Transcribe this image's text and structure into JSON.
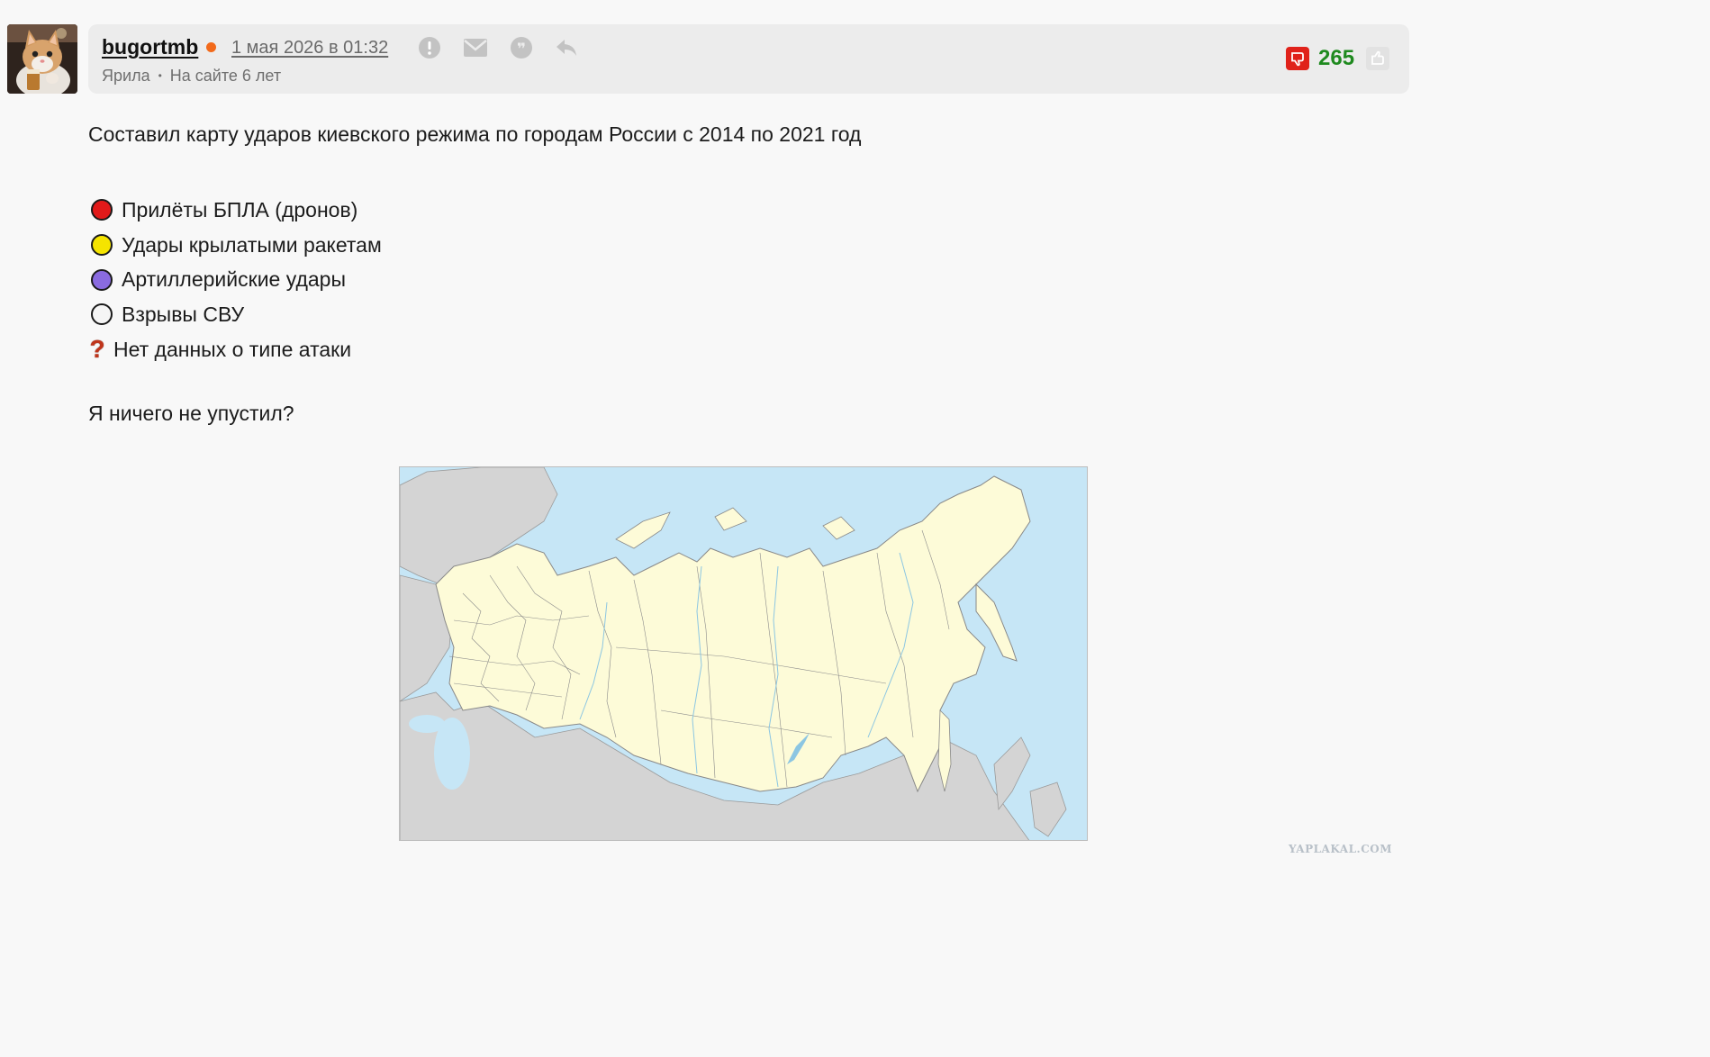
{
  "post": {
    "author": "bugortmb",
    "online_color": "#f26a1b",
    "date": "1 мая 2026 в 01:32",
    "user_status": "Ярила",
    "meta_separator": "•",
    "member_since": "На сайте 6 лет",
    "rating": "265",
    "rating_color": "#1f8a1f",
    "icons": [
      "report-icon",
      "message-icon",
      "quote-icon",
      "reply-icon",
      "dislike-icon",
      "like-icon"
    ]
  },
  "content": {
    "intro": "Составил карту ударов киевского режима по городам России с 2014 по 2021 год",
    "legend": [
      {
        "label": "Прилёты БПЛА (дронов)",
        "color": "#e11a1a"
      },
      {
        "label": "Удары крылатыми ракетам",
        "color": "#f5e400"
      },
      {
        "label": "Артиллерийские удары",
        "color": "#8a6be0"
      },
      {
        "label": "Взрывы СВУ",
        "color": "#f5f5f5"
      },
      {
        "label": "Нет данных о типе атаки",
        "icon": "question-mark-icon"
      }
    ],
    "closing": "Я ничего не упустил?"
  },
  "map": {
    "icon": "russia-map",
    "colors": {
      "sea": "#c6e6f6",
      "russia": "#fdfbd8",
      "neighbors": "#d4d4d4",
      "borders": "#888888",
      "rivers": "#8cc6e2"
    }
  },
  "watermark": "YAPLAKAL.COM"
}
